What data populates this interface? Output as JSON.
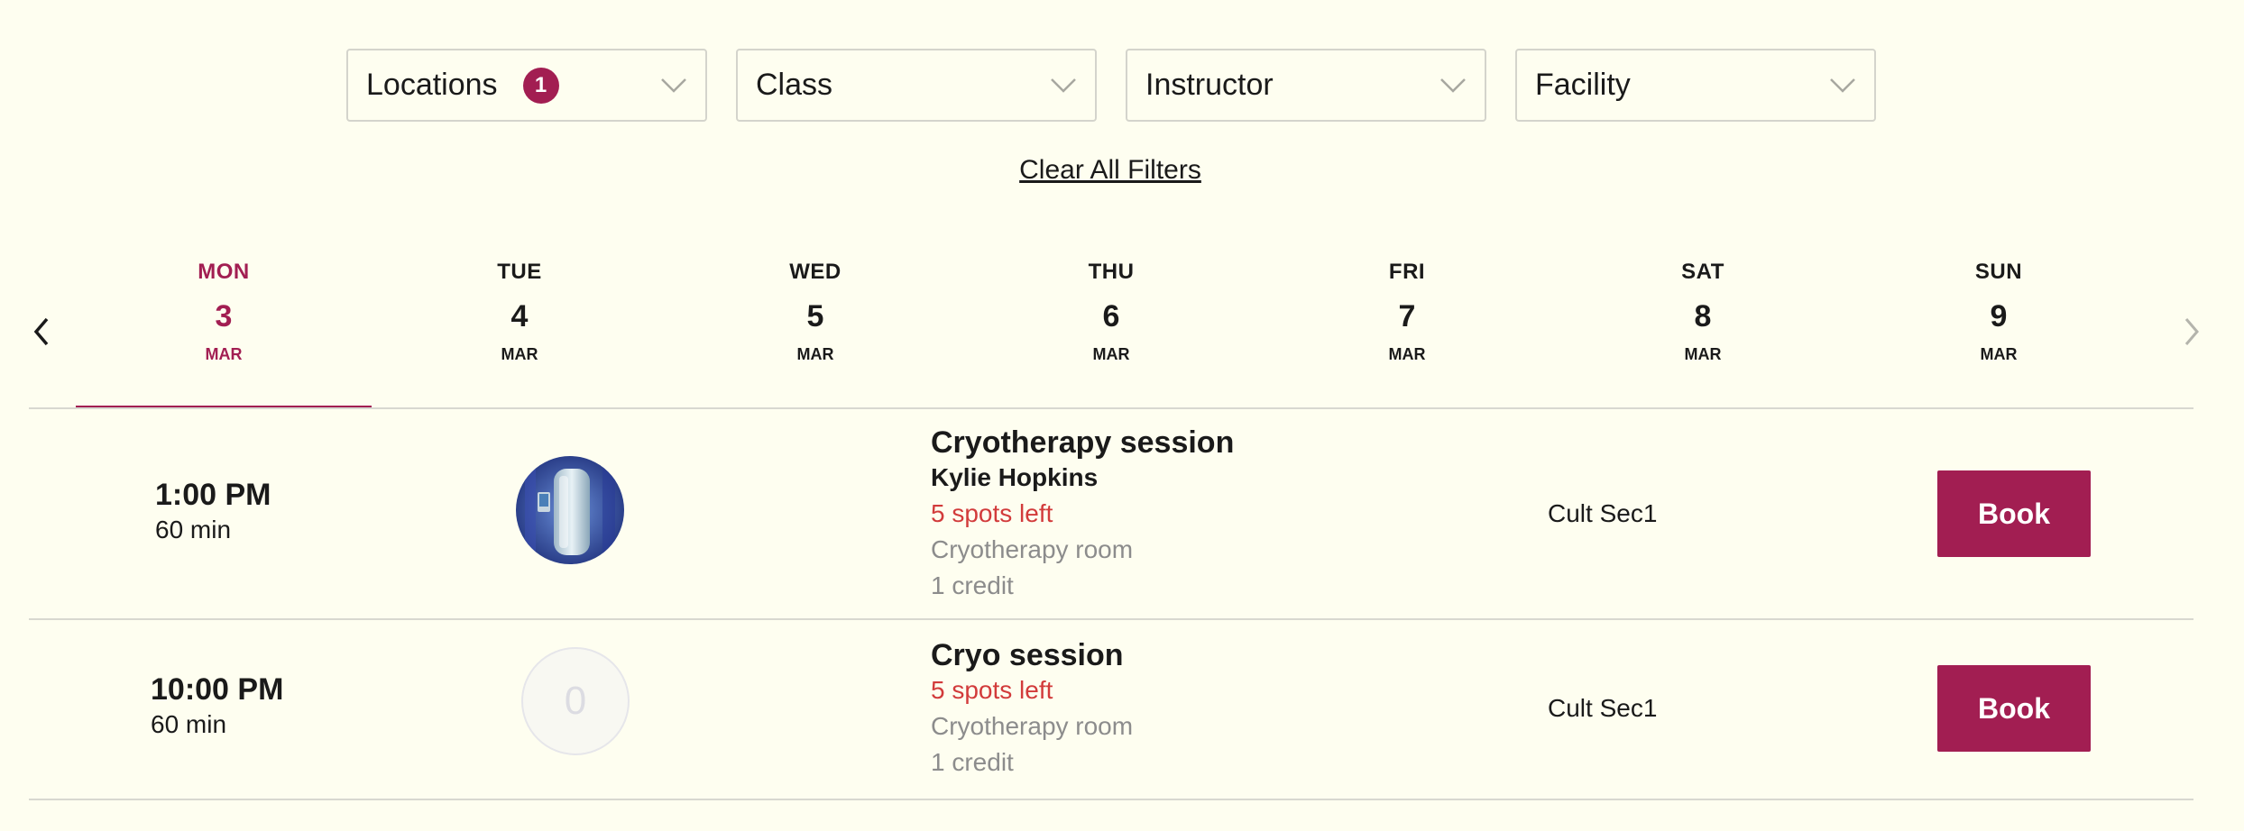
{
  "filters": [
    {
      "label": "Locations",
      "badge": "1"
    },
    {
      "label": "Class"
    },
    {
      "label": "Instructor"
    },
    {
      "label": "Facility"
    }
  ],
  "clear_filters_label": "Clear All Filters",
  "days": [
    {
      "dow": "MON",
      "num": "3",
      "mon": "MAR",
      "active": true
    },
    {
      "dow": "TUE",
      "num": "4",
      "mon": "MAR"
    },
    {
      "dow": "WED",
      "num": "5",
      "mon": "MAR"
    },
    {
      "dow": "THU",
      "num": "6",
      "mon": "MAR"
    },
    {
      "dow": "FRI",
      "num": "7",
      "mon": "MAR"
    },
    {
      "dow": "SAT",
      "num": "8",
      "mon": "MAR"
    },
    {
      "dow": "SUN",
      "num": "9",
      "mon": "MAR"
    }
  ],
  "sessions": [
    {
      "time": "1:00 PM",
      "duration": "60 min",
      "title": "Cryotherapy session",
      "instructor": "Kylie Hopkins",
      "spots": "5 spots left",
      "room": "Cryotherapy room",
      "credit": "1 credit",
      "location": "Cult Sec1",
      "book_label": "Book"
    },
    {
      "time": "10:00 PM",
      "duration": "60 min",
      "thumb_placeholder": "0",
      "title": "Cryo session",
      "spots": "5 spots left",
      "room": "Cryotherapy room",
      "credit": "1 credit",
      "location": "Cult Sec1",
      "book_label": "Book"
    }
  ],
  "colors": {
    "accent": "#a21e52",
    "background": "#fefef0",
    "spots_text": "#d23b3b",
    "muted_text": "#8c8c8c"
  }
}
